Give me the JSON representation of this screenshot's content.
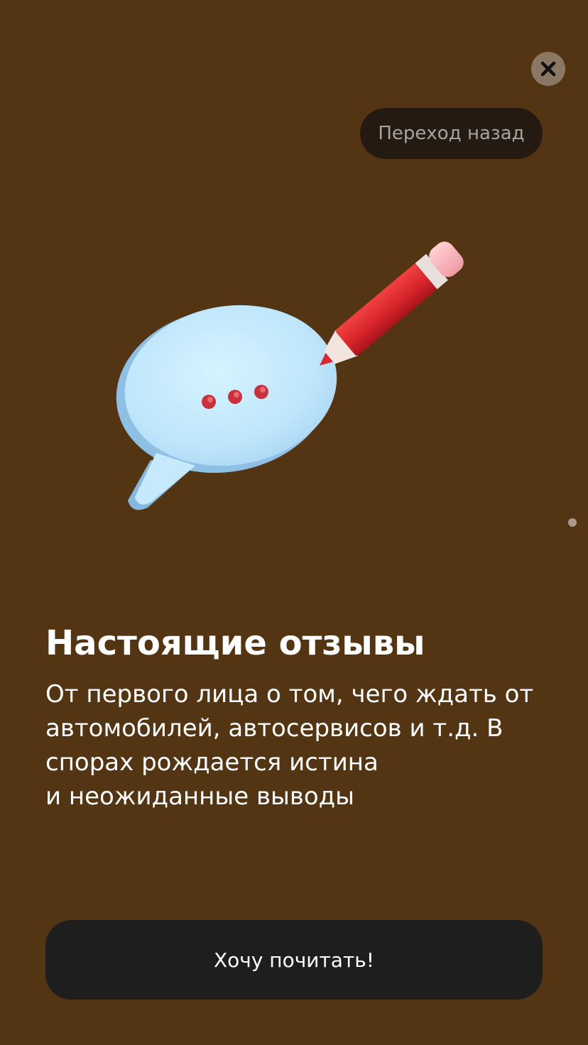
{
  "close_button": {
    "icon": "close-icon"
  },
  "back_button": {
    "label": "Переход назад"
  },
  "illustration": {
    "icons": [
      "speech-bubble-icon",
      "pencil-icon"
    ]
  },
  "pagination": {
    "dot_color": "#a99b8c"
  },
  "content": {
    "title": "Настоящие отзывы",
    "description_lines": [
      "От первого лица о том, чего ждать от",
      "автомобилей, автосервисов и т.д. В",
      "спорах рождается истина",
      "и неожиданные выводы"
    ]
  },
  "cta": {
    "label": "Хочу почитать!"
  },
  "colors": {
    "background": "#533413",
    "button": "#1f1e1f",
    "back_pill": "#241a12",
    "close_bg": "#8a7865",
    "text": "#ffffff"
  }
}
